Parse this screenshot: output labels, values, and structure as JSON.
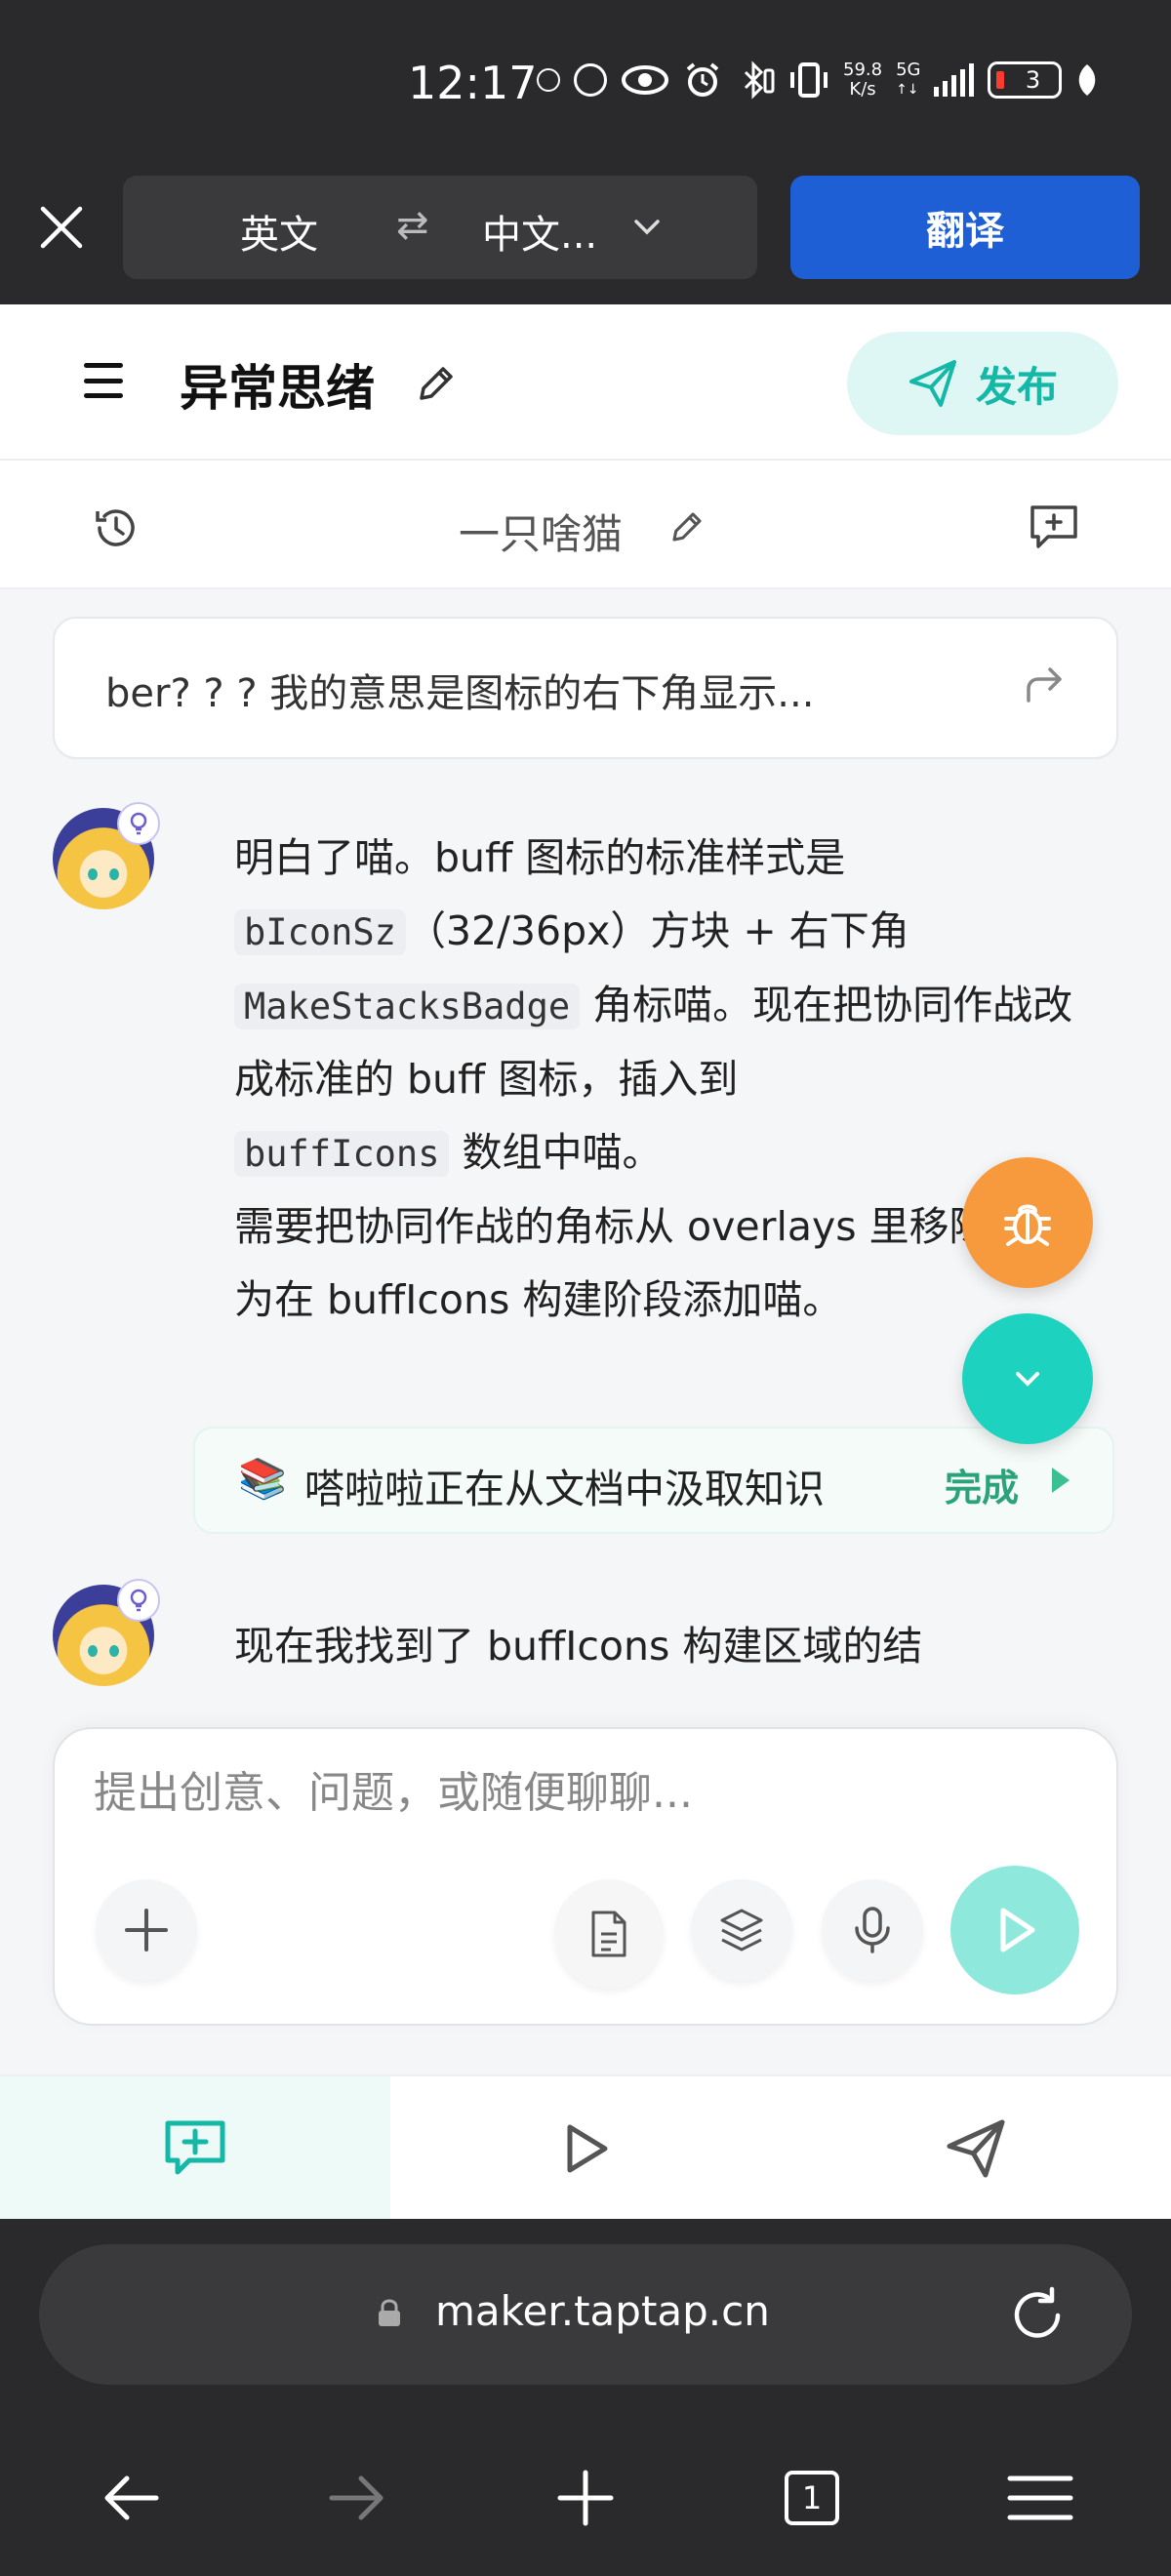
{
  "status_bar": {
    "time": "12:17",
    "net_speed": "59.8\nK/s",
    "net_type": "5G",
    "battery": "3"
  },
  "translate_bar": {
    "source_lang": "英文",
    "swap_icon": "⇄",
    "target_lang": "中文...",
    "translate_label": "翻译"
  },
  "header": {
    "title": "异常思绪",
    "publish_label": "发布"
  },
  "subheader": {
    "chat_name": "一只啥猫"
  },
  "quote": {
    "text": "ber? ? ? 我的意思是图标的右下角显示..."
  },
  "message1": {
    "line1_a": "明白了喵。buff 图标的标准样式是",
    "code1": "bIconSz",
    "line2_b": "（32/36px）方块 + 右下角",
    "code2": "MakeStacksBadge",
    "line3_b": " 角标喵。现在把协同作战改成标准的 buff 图标，插入到",
    "code3": "buffIcons",
    "line4_b": " 数组中喵。",
    "line5": "需要把协同作战的角标从 overlays 里移除，改为在 buffIcons 构建阶段添加喵。"
  },
  "tool_status": {
    "icon": "📚",
    "text": "嗒啦啦正在从文档中汲取知识",
    "status": "完成"
  },
  "message2": {
    "text": "现在我找到了 buffIcons 构建区域的结"
  },
  "composer": {
    "placeholder": "提出创意、问题，或随便聊聊..."
  },
  "browser": {
    "url": "maker.taptap.cn",
    "tab_count": "1"
  },
  "colors": {
    "accent": "#14b8a6",
    "translate_blue": "#1f5fd6",
    "bug_orange": "#f79a3e",
    "fab_teal": "#1dd3c0"
  }
}
